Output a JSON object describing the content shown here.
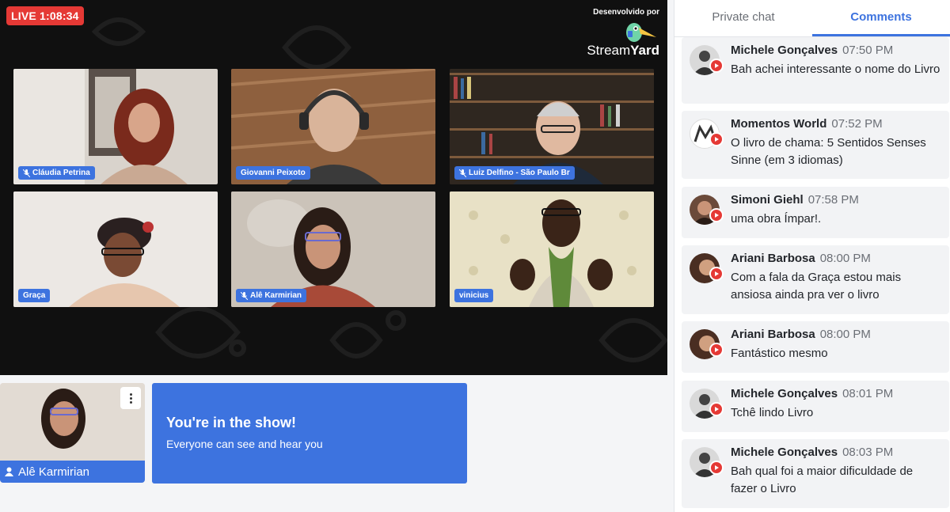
{
  "stage": {
    "live_label": "LIVE 1:08:34",
    "brand_caption": "Desenvolvido por",
    "brand_name_light": "Stream",
    "brand_name_bold": "Yard"
  },
  "participants": [
    {
      "name": "Cláudia Petrina",
      "muted": true
    },
    {
      "name": "Giovanni Peixoto",
      "muted": false
    },
    {
      "name": "Luiz Delfino - São Paulo Br",
      "muted": true
    },
    {
      "name": "Graça",
      "muted": false
    },
    {
      "name": "Alê Karmirian",
      "muted": true
    },
    {
      "name": "vinicius",
      "muted": false
    }
  ],
  "self_view": {
    "name": "Alê Karmirian"
  },
  "banner": {
    "title": "You're in the show!",
    "subtitle": "Everyone can see and hear you"
  },
  "sidebar": {
    "tabs": [
      "Private chat",
      "Comments"
    ],
    "active_tab": "Comments",
    "comments": [
      {
        "author": "Michele Gonçalves",
        "time": "07:50 PM",
        "text": "Bah achei interessante o nome do Livro"
      },
      {
        "author": "Momentos World",
        "time": "07:52 PM",
        "text": "O livro de chama: 5 Sentidos Senses Sinne (em 3 idiomas)"
      },
      {
        "author": "Simoni Giehl",
        "time": "07:58 PM",
        "text": "uma obra Ímpar!."
      },
      {
        "author": "Ariani Barbosa",
        "time": "08:00 PM",
        "text": "Com a fala da Graça estou mais ansiosa ainda pra ver o livro"
      },
      {
        "author": "Ariani Barbosa",
        "time": "08:00 PM",
        "text": "Fantástico mesmo"
      },
      {
        "author": "Michele Gonçalves",
        "time": "08:01 PM",
        "text": "Tchê lindo Livro"
      },
      {
        "author": "Michele Gonçalves",
        "time": "08:03 PM",
        "text": "Bah qual foi a maior dificuldade de fazer o Livro"
      }
    ]
  },
  "colors": {
    "accent": "#3d73df",
    "live": "#e53935",
    "stage_bg": "#101010"
  }
}
